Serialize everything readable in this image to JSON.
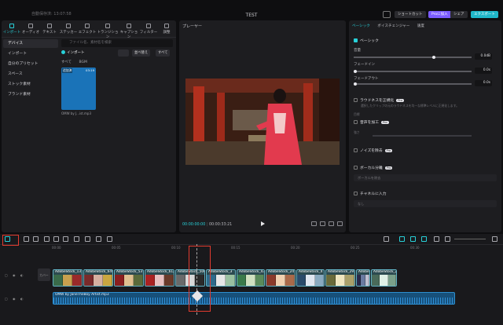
{
  "titlebar": {
    "autosave": "自動保存済: 13:07:58",
    "project": "TEST",
    "shortcut": "ショートカット",
    "pro": "Proに加入",
    "share": "シェア",
    "export": "エクスポート"
  },
  "media": {
    "tabs": [
      "インポート",
      "オーディオ",
      "テキスト",
      "ステッカー",
      "エフェクト",
      "トランジション",
      "キャプション",
      "フィルター",
      "調整"
    ],
    "nav": [
      "デバイス",
      "インポート",
      "自分のプリセット",
      "スペース",
      "ストック素材",
      "ブランド素材"
    ],
    "search_placeholder": "ファイル名、素材名を検索",
    "import_label": "インポート",
    "sort_label": "並べ替え",
    "all_label": "すべて",
    "subtabs": [
      "すべて",
      "BGM"
    ],
    "thumb": {
      "tag": "追加済",
      "duration": "03:19",
      "name": "OMW by J...ist.mp3"
    }
  },
  "player": {
    "title": "プレーヤー",
    "current": "00:00:00:00",
    "total": "00:00:33:21"
  },
  "props": {
    "tabs": [
      "ベーシック",
      "ボイスチェンジャー",
      "速度"
    ],
    "basic": "ベーシック",
    "volume": "音量",
    "volume_val": "0.0dB",
    "fadein": "フェードイン",
    "fadein_val": "0.0s",
    "fadeout": "フェードアウト",
    "fadeout_val": "0.0s",
    "loudness": "ラウドネスを正規化",
    "loudness_desc": "選択したクリップの元のラウドネスを均一な標準レベルに正規化します。",
    "loudness_level": "目標",
    "enhance": "音声を加工",
    "enhance_level": "強さ",
    "noise": "ノイズを除去",
    "vocal": "ボーカル分離",
    "vocal_placeholder": "ボーカルを除去",
    "channel": "チャネルに入力",
    "channel_placeholder": "なし",
    "pro_badge": "Pro"
  },
  "timeline": {
    "ticks": [
      "00:00",
      "00:05",
      "00:10",
      "00:15",
      "00:20",
      "00:25",
      "00:30"
    ],
    "track_cover": "カバー",
    "clips": [
      "AdobeStock_131",
      "AdobeStock_649",
      "AdobeStock_53",
      "AdobeStock_612",
      "AdobeStock_500",
      "AdobeStock_3",
      "AdobeStock_43",
      "AdobeStock_24",
      "AdobeStock_4",
      "AdobeStock_291",
      "Adobel",
      "AdobeStock_23"
    ],
    "audio": "OMW by JaneTheBoy Artist.mp3"
  },
  "colors": {
    "accent": "#28d1d9",
    "highlight": "#e23b2f",
    "pro": "#7b5cff",
    "export": "#1fb7c9"
  }
}
